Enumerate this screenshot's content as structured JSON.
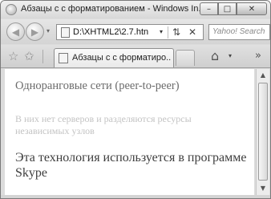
{
  "window": {
    "title": "Абзацы с с форматированием - Windows In...",
    "minimize_glyph": "–",
    "maximize_glyph": "□",
    "close_glyph": "✕"
  },
  "navigation": {
    "back_glyph": "◀",
    "forward_glyph": "▶",
    "dropdown_glyph": "▾",
    "address": "D:\\XHTML2\\2.7.htn",
    "address_dropdown_glyph": "▾",
    "refresh_glyph": "⇅",
    "stop_glyph": "✕",
    "search_placeholder": "Yahoo! Search"
  },
  "tabs": {
    "favorites_glyph": "☆",
    "add_favorite_glyph": "✩",
    "active_tab_label": "Абзацы с с форматиро...",
    "home_glyph": "⌂",
    "home_dropdown_glyph": "▾",
    "more_glyph": "»"
  },
  "content": {
    "paragraph1": "Одноранговые сети (peer-to-peer)",
    "paragraph2": "В них нет серверов и разделяются ресурсы независимых узлов",
    "paragraph3": "Эта технология используется в программе Skype"
  },
  "scrollbar": {
    "up_glyph": "▲",
    "down_glyph": "▼"
  },
  "colors": {
    "paragraph1": "#6b6b6b",
    "paragraph2": "#c3c3c3",
    "paragraph3": "#3e3e3e",
    "chrome": "#dcdcdc"
  }
}
